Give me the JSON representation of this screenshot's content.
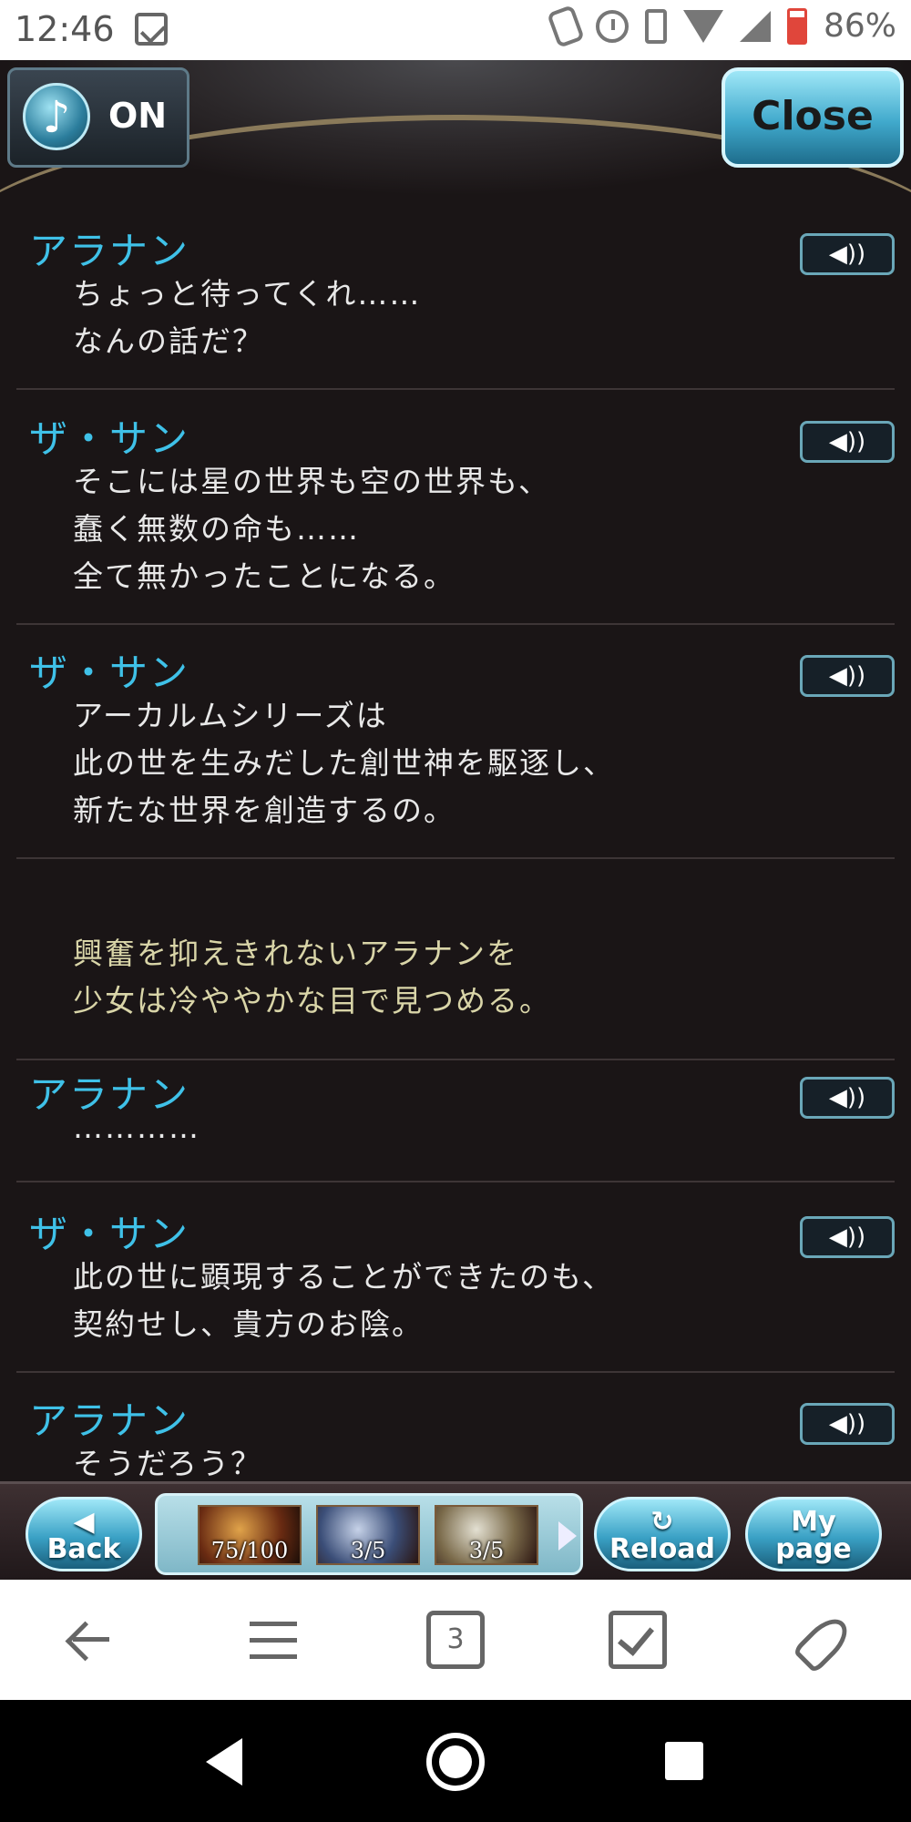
{
  "status_bar": {
    "time": "12:46",
    "battery_percent": "86%",
    "icons": [
      "notification-icon",
      "nfc-icon",
      "alarm-icon",
      "vibrate-icon",
      "wifi-icon",
      "signal-icon",
      "battery-icon"
    ]
  },
  "header": {
    "bgm_label": "ON",
    "bgm_icon": "♪",
    "close_label": "Close"
  },
  "log": {
    "entries": [
      {
        "speaker": "アラナン",
        "lines": [
          "ちょっと待ってくれ……",
          "なんの話だ？"
        ]
      },
      {
        "speaker": "ザ・サン",
        "lines": [
          "そこには星の世界も空の世界も、",
          "蠢く無数の命も……",
          "全て無かったことになる。"
        ]
      },
      {
        "speaker": "ザ・サン",
        "lines": [
          "アーカルムシリーズは",
          "此の世を生みだした創世神を駆逐し、",
          "新たな世界を創造するの。"
        ]
      },
      {
        "narration": [
          "興奮を抑えきれないアラナンを",
          "少女は冷ややかな目で見つめる。"
        ]
      },
      {
        "speaker": "アラナン",
        "lines": [
          "…………"
        ]
      },
      {
        "speaker": "ザ・サン",
        "lines": [
          "此の世に顕現することができたのも、",
          "契約せし、貴方のお陰。"
        ]
      },
      {
        "speaker": "アラナン",
        "lines": [
          "そうだろう？"
        ]
      }
    ],
    "voice_icon": "◀))"
  },
  "game_nav": {
    "back_label": "Back",
    "reload_label": "Reload",
    "mypage_label_1": "My",
    "mypage_label_2": "page",
    "items": [
      {
        "count": "75/100"
      },
      {
        "count": "3/5"
      },
      {
        "count": "3/5"
      }
    ]
  },
  "browser_bar": {
    "tab_count": "3"
  }
}
